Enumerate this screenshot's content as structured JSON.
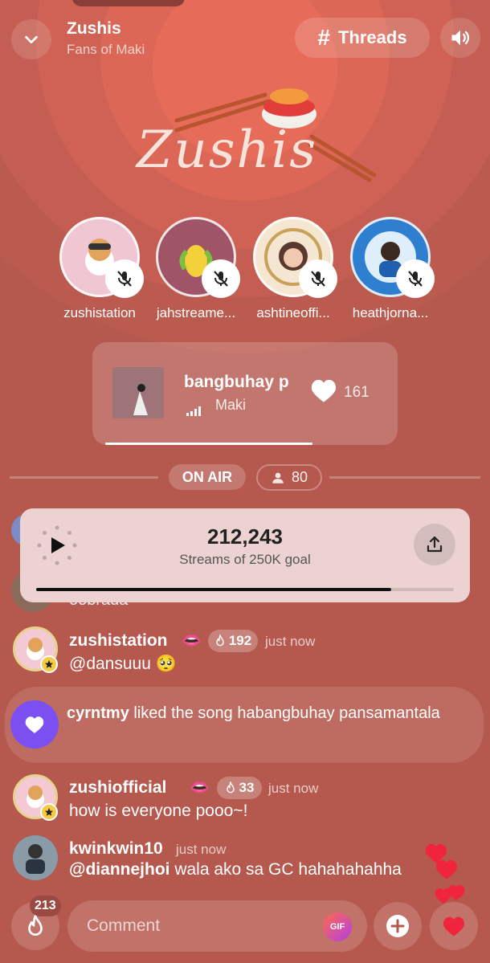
{
  "header": {
    "title": "Zushis",
    "subtitle": "Fans of Maki",
    "threads_label": "Threads",
    "threads_icon": "hash-icon",
    "sound_icon": "speaker-icon",
    "back_icon": "chevron-down-icon"
  },
  "logo": {
    "text": "Zushis"
  },
  "speakers": [
    {
      "name": "zushistation",
      "avatar_color": "#f1c6d3",
      "muted": true
    },
    {
      "name": "jahstreame...",
      "avatar_color": "#a05467",
      "muted": true
    },
    {
      "name": "ashtineoffi...",
      "avatar_color": "#f5e6d2",
      "muted": true
    },
    {
      "name": "heathjorna...",
      "avatar_color": "#2f7fd1",
      "muted": true
    }
  ],
  "song": {
    "title": "bangbuhay p",
    "artist": "Maki",
    "likes": "161",
    "progress_fraction": 0.68
  },
  "status": {
    "on_air": "ON AIR",
    "listener_count": "80"
  },
  "streams": {
    "count": "212,243",
    "goal_text": "Streams of 250K goal",
    "progress_fraction": 0.85
  },
  "partial_message": {
    "text": "oobrada"
  },
  "chat": [
    {
      "name": "zushistation",
      "fire_count": "192",
      "time": "just now",
      "text": "@dansuuu 🥺"
    },
    {
      "name": "zushiofficial",
      "fire_count": "33",
      "time": "just now",
      "text": "how is everyone pooo~!"
    },
    {
      "name": "kwinkwin10",
      "time": "just now",
      "text_mention": "@diannejhoi",
      "text": "wala ako sa GC hahahahahha"
    }
  ],
  "like_event": {
    "user": "cyrntmy",
    "action": "liked the song habangbuhay pansamantala"
  },
  "bottom": {
    "fire_count": "213",
    "comment_placeholder": "Comment",
    "gif_label": "GIF"
  },
  "colors": {
    "background": "#b5584d",
    "like_purple": "#7b4ff0",
    "heart_red": "#f0253b"
  }
}
